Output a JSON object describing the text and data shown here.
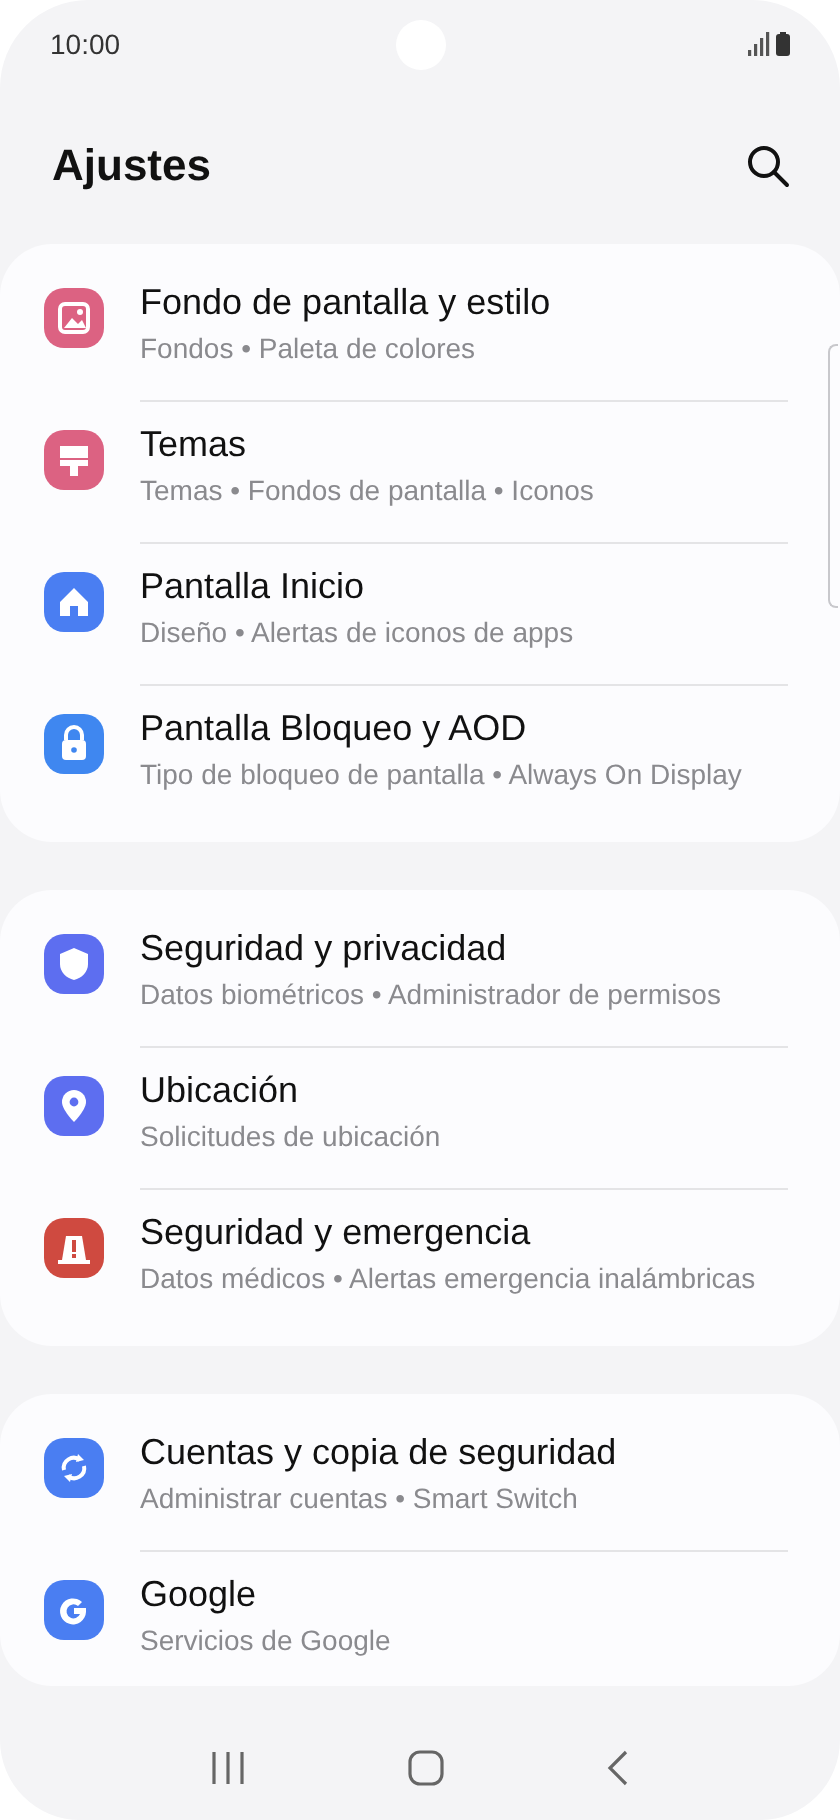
{
  "status_bar": {
    "time": "10:00"
  },
  "header": {
    "title": "Ajustes"
  },
  "groups": [
    {
      "items": [
        {
          "kind": "wallpaper",
          "color": "#dc6282",
          "title": "Fondo de pantalla y estilo",
          "subtitle": "Fondos • Paleta de colores"
        },
        {
          "kind": "brush",
          "color": "#dc6282",
          "title": "Temas",
          "subtitle": "Temas • Fondos de pantalla • Iconos"
        },
        {
          "kind": "home",
          "color": "#4a7ef2",
          "title": "Pantalla Inicio",
          "subtitle": "Diseño • Alertas de iconos de apps"
        },
        {
          "kind": "lock",
          "color": "#3f87f0",
          "title": "Pantalla Bloqueo y AOD",
          "subtitle": "Tipo de bloqueo de pantalla • Always On Display"
        }
      ]
    },
    {
      "items": [
        {
          "kind": "shield",
          "color": "#5d6ef0",
          "title": "Seguridad y privacidad",
          "subtitle": "Datos biométricos • Administrador de permisos"
        },
        {
          "kind": "pin",
          "color": "#5d6ef0",
          "title": "Ubicación",
          "subtitle": "Solicitudes de ubicación"
        },
        {
          "kind": "alert",
          "color": "#cf4a40",
          "title": "Seguridad y emergencia",
          "subtitle": "Datos médicos • Alertas emergencia inalámbricas"
        }
      ]
    },
    {
      "items": [
        {
          "kind": "sync",
          "color": "#4a7ef2",
          "title": "Cuentas y copia de seguridad",
          "subtitle": "Administrar cuentas • Smart Switch"
        },
        {
          "kind": "google",
          "color": "#4a7ef2",
          "title": "Google",
          "subtitle": "Servicios de Google"
        }
      ]
    }
  ]
}
